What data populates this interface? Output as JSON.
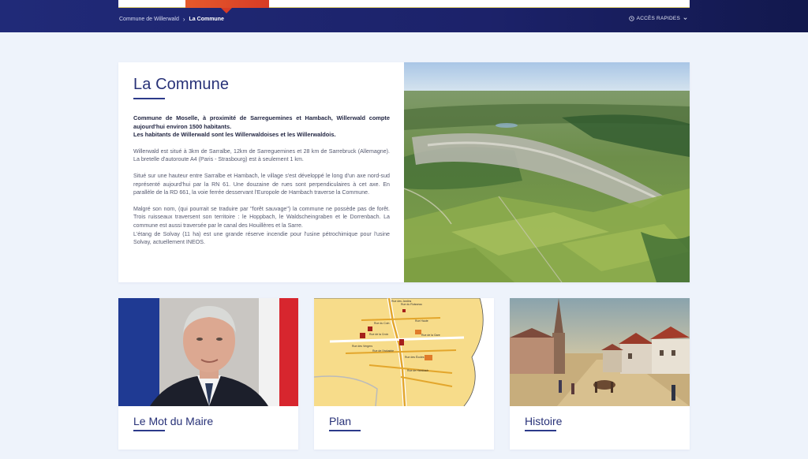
{
  "breadcrumb": {
    "home": "Commune de Willerwald",
    "separator": "›",
    "current": "La Commune"
  },
  "quick_access": {
    "label": "ACCÈS RAPIDES",
    "icon": "clock-icon",
    "caret": "chevron-down-icon"
  },
  "intro": {
    "title": "La Commune",
    "lead_1": "Commune de Moselle, à proximité de Sarreguemines et Hambach, Willerwald compte aujourd'hui environ 1500 habitants.",
    "lead_2": "Les habitants de Willerwald sont les Willerwaldoises et les Willerwaldois.",
    "para_1": "Willerwald est situé à 3km de Sarralbe, 12km de Sarreguemines et 28 km de Sarrebruck (Allemagne). La bretelle d'autoroute A4 (Paris - Strasbourg) est à seulement 1 km.",
    "para_2": "Situé sur une hauteur entre Sarralbe et Hambach, le village s'est développé le long d'un axe nord-sud représenté aujourd'hui par la RN 61. Une douzaine de rues sont perpendiculaires à cet axe.  En parallèle de la RD 661, la voie ferrée desservant l'Europole de Hambach traverse la Commune.",
    "para_3a": "Malgré son nom, (qui pourrait se traduire par \"forêt sauvage\") la commune ne possède pas de forêt. Trois ruisseaux traversent son territoire : le Hoppbach, le Waldscheingraben et le Dorrenbach. La commune est aussi traversée par le canal des Houillères et la Sarre.",
    "para_3b": "L'étang de Solvay (11 ha) est une grande réserve incendie pour l'usine pétrochimique pour l'usine Solvay, actuellement INEOS."
  },
  "cards": [
    {
      "label": "Le Mot du Maire"
    },
    {
      "label": "Plan"
    },
    {
      "label": "Histoire"
    }
  ],
  "map_streets": [
    "Rue des Jardins",
    "Rue du Ruisseau",
    "Rue du Coin",
    "Rue Haute",
    "Rue de la Croix",
    "Rue de la Gare",
    "Rue des Vergers",
    "Rue de l'Industrie",
    "Rue des Écoles",
    "Rue de Hambach"
  ],
  "colors": {
    "header": "#1c226a",
    "accent": "#d83c26",
    "title": "#283278",
    "background": "#eef3fb"
  }
}
